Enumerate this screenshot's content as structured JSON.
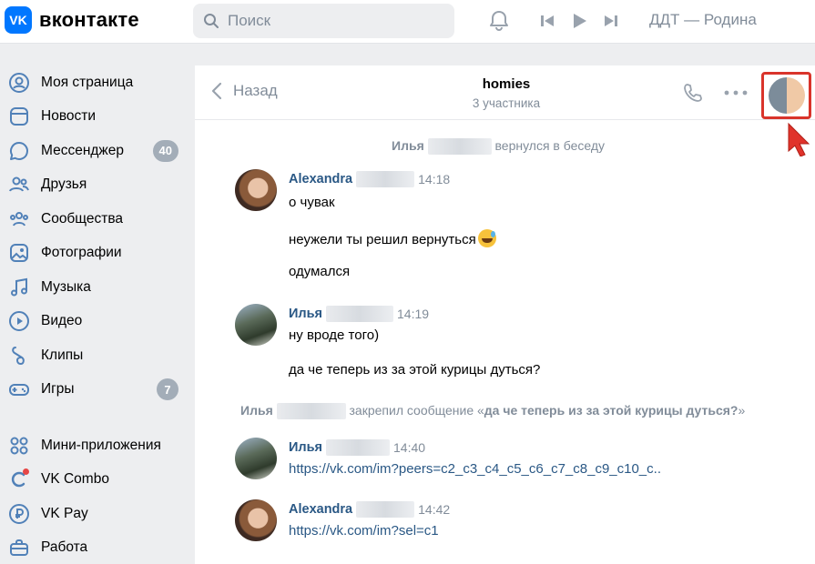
{
  "header": {
    "logo_mark": "VK",
    "logo_text": "вконтакте",
    "search_placeholder": "Поиск",
    "now_playing": "ДДТ — Родина"
  },
  "sidebar": {
    "items": [
      {
        "label": "Моя страница",
        "icon": "user-circle-icon"
      },
      {
        "label": "Новости",
        "icon": "news-icon"
      },
      {
        "label": "Мессенджер",
        "icon": "message-icon",
        "badge": "40"
      },
      {
        "label": "Друзья",
        "icon": "friends-icon"
      },
      {
        "label": "Сообщества",
        "icon": "communities-icon"
      },
      {
        "label": "Фотографии",
        "icon": "photo-icon"
      },
      {
        "label": "Музыка",
        "icon": "music-icon"
      },
      {
        "label": "Видео",
        "icon": "video-icon"
      },
      {
        "label": "Клипы",
        "icon": "clips-icon"
      },
      {
        "label": "Игры",
        "icon": "gamepad-icon",
        "badge": "7"
      },
      {
        "label": "Мини-приложения",
        "icon": "apps-icon"
      },
      {
        "label": "VK Combo",
        "icon": "combo-icon"
      },
      {
        "label": "VK Pay",
        "icon": "ruble-icon"
      },
      {
        "label": "Работа",
        "icon": "briefcase-icon"
      }
    ]
  },
  "chat": {
    "back_label": "Назад",
    "title": "homies",
    "subtitle": "3 участника",
    "events": [
      {
        "name": "Илья",
        "text": "вернулся в беседу"
      },
      {
        "name": "Илья",
        "text_prefix": "закрепил сообщение «",
        "pinned": "да че теперь из за этой курицы дуться?",
        "text_suffix": "»"
      }
    ],
    "messages": [
      {
        "author": "Alexandra",
        "time": "14:18",
        "lines": [
          "о чувак",
          "неужели ты решил вернуться",
          "одумался"
        ]
      },
      {
        "author": "Илья",
        "time": "14:19",
        "lines": [
          "ну вроде того)",
          "да че теперь из за этой курицы дуться?"
        ]
      },
      {
        "author": "Илья",
        "time": "14:40",
        "link": "https://vk.com/im?peers=c2_c3_c4_c5_c6_c7_c8_c9_c10_c.."
      },
      {
        "author": "Alexandra",
        "time": "14:42",
        "link": "https://vk.com/im?sel=c1"
      }
    ]
  },
  "colors": {
    "brand": "#0077ff",
    "link": "#2a5885",
    "muted": "#818c99",
    "highlight": "#d9342b"
  }
}
